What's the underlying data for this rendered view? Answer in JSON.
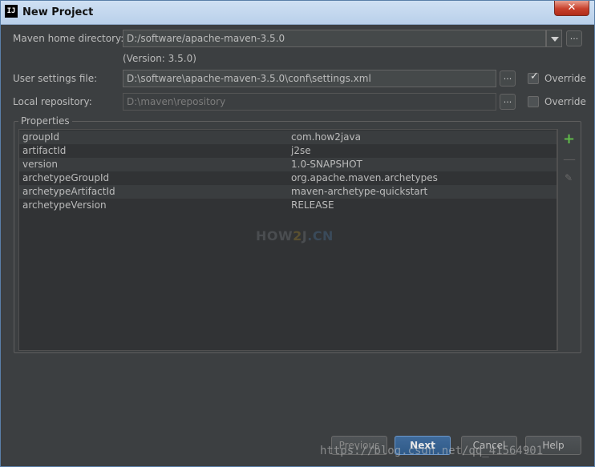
{
  "window": {
    "title": "New Project",
    "logo_text": "IJ",
    "close_label": "✕"
  },
  "maven_home": {
    "label": "Maven home directory:",
    "value": "D:/software/apache-maven-3.5.0",
    "version": "(Version: 3.5.0)"
  },
  "user_settings": {
    "label": "User settings file:",
    "value": "D:\\software\\apache-maven-3.5.0\\conf\\settings.xml",
    "override_label": "Override",
    "override_checked": true
  },
  "local_repo": {
    "label": "Local repository:",
    "value": "D:\\maven\\repository",
    "override_label": "Override",
    "override_checked": false
  },
  "browse_label": "...",
  "properties": {
    "title": "Properties",
    "rows": [
      {
        "key": "groupId",
        "value": "com.how2java"
      },
      {
        "key": "artifactId",
        "value": "j2se"
      },
      {
        "key": "version",
        "value": "1.0-SNAPSHOT"
      },
      {
        "key": "archetypeGroupId",
        "value": "org.apache.maven.archetypes"
      },
      {
        "key": "archetypeArtifactId",
        "value": "maven-archetype-quickstart"
      },
      {
        "key": "archetypeVersion",
        "value": "RELEASE"
      }
    ],
    "watermark": {
      "a": "HOW",
      "b": "2",
      "c": "J",
      "d": ".CN"
    }
  },
  "buttons": {
    "previous": "Previous",
    "next": "Next",
    "cancel": "Cancel",
    "help": "Help"
  },
  "footer_url": "https://blog.csdn.net/qq_41564901"
}
